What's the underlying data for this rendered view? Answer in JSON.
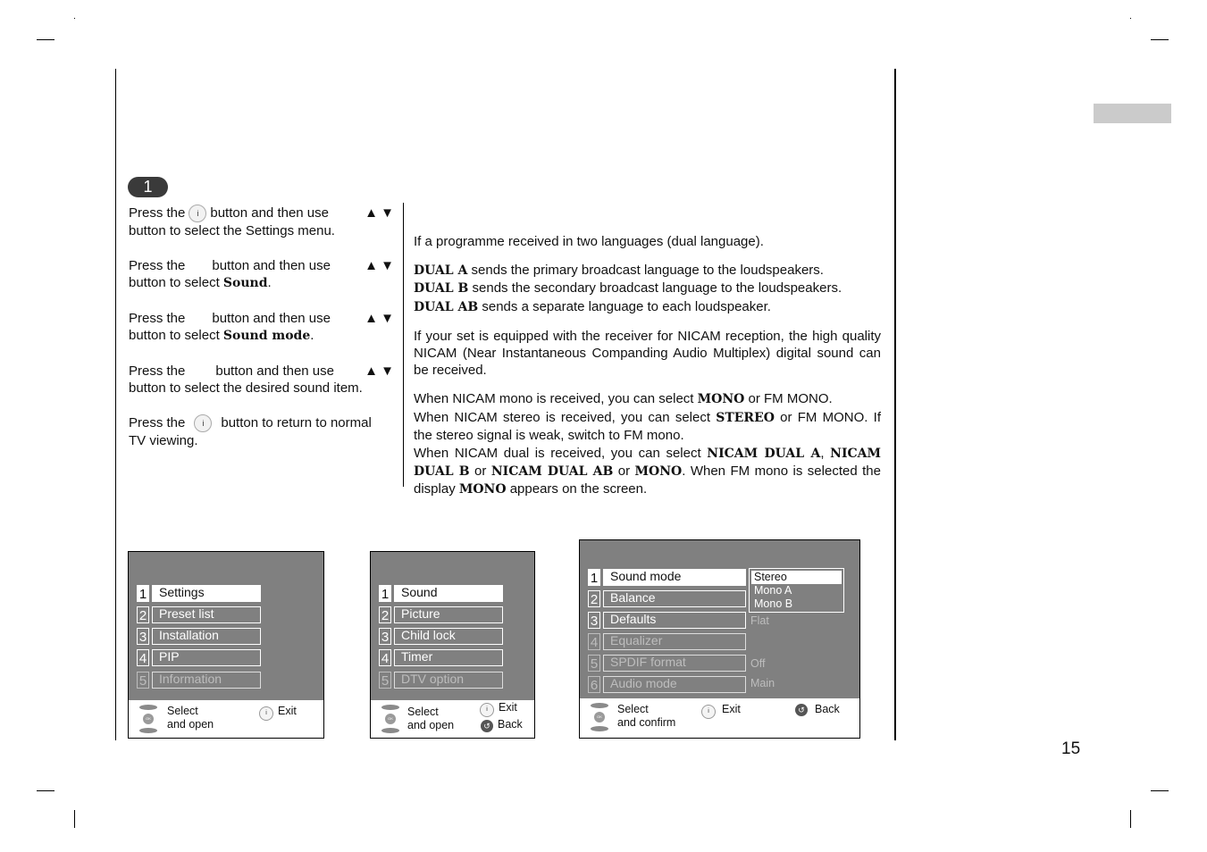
{
  "page": {
    "page_number": "15",
    "step_badge": "1"
  },
  "steps": [
    {
      "pre": "Press the",
      "button_icon": "i-button",
      "post": "button and then use",
      "arrows": [
        "▲",
        "▼"
      ],
      "line2_pre": "button to select the Settings menu.",
      "line2_bold": "",
      "line2_post": ""
    },
    {
      "pre": "Press the",
      "button_icon": "",
      "post": "button and then use",
      "arrows": [
        "▲",
        "▼"
      ],
      "line2_pre": "button to select ",
      "line2_bold": "Sound",
      "line2_post": "."
    },
    {
      "pre": "Press the",
      "button_icon": "",
      "post": "button and then use",
      "arrows": [
        "▲",
        "▼"
      ],
      "line2_pre": "button to select ",
      "line2_bold": "Sound mode",
      "line2_post": "."
    },
    {
      "pre": "Press the",
      "button_icon": "",
      "post": "button and then use",
      "arrows": [
        "▲",
        "▼"
      ],
      "line2_pre": "button to select the desired sound item.",
      "line2_bold": "",
      "line2_post": ""
    },
    {
      "pre": "Press the",
      "button_icon": "i-button",
      "post": "button to return to normal",
      "line2_pre": "TV viewing."
    }
  ],
  "right_text": {
    "intro": "If a programme received in two languages (dual language).",
    "dual": [
      {
        "bold": "DUAL A",
        "text": " sends the primary broadcast language to the loudspeakers."
      },
      {
        "bold": "DUAL B",
        "text": " sends the secondary broadcast language to the loudspeakers."
      },
      {
        "bold": "DUAL AB",
        "text": " sends a separate language to each loudspeaker."
      }
    ],
    "nicam_para": "If your set is equipped with the receiver for NICAM reception, the high quality NICAM (Near Instantaneous Companding Audio Multiplex) digital sound can be received.",
    "mono_line": {
      "a": "When NICAM mono is received, you can select ",
      "b": "MONO",
      "c": " or FM MONO."
    },
    "stereo_line": {
      "a": "When NICAM stereo is received, you can select ",
      "b": "STEREO",
      "c": " or FM MONO. If the stereo signal is weak, switch to FM mono."
    },
    "dual_line": {
      "a": "When NICAM dual is received, you can select ",
      "b1": "NICAM DUAL A",
      "c": ", ",
      "b2": "NICAM DUAL B",
      "d": " or ",
      "b3": "NICAM DUAL AB",
      "e": " or ",
      "b4": "MONO",
      "f": ". When FM mono is selected the display ",
      "b5": "MONO",
      "g": " appears on the screen."
    }
  },
  "osd1": {
    "items": [
      {
        "num": "1",
        "label": "Settings"
      },
      {
        "num": "2",
        "label": "Preset list"
      },
      {
        "num": "3",
        "label": "Installation"
      },
      {
        "num": "4",
        "label": "PIP"
      },
      {
        "num": "5",
        "label": "Information"
      }
    ],
    "footer": {
      "select": "Select",
      "select2": "and open",
      "exit": "Exit",
      "ok": "OK"
    }
  },
  "osd2": {
    "items": [
      {
        "num": "1",
        "label": "Sound"
      },
      {
        "num": "2",
        "label": "Picture"
      },
      {
        "num": "3",
        "label": "Child lock"
      },
      {
        "num": "4",
        "label": "Timer"
      },
      {
        "num": "5",
        "label": "DTV option"
      }
    ],
    "footer": {
      "select": "Select",
      "select2": "and open",
      "exit": "Exit",
      "back": "Back",
      "ok": "OK"
    }
  },
  "osd3": {
    "items": [
      {
        "num": "1",
        "label": "Sound mode",
        "value": ""
      },
      {
        "num": "2",
        "label": "Balance",
        "value": ""
      },
      {
        "num": "3",
        "label": "Defaults",
        "value": "Flat"
      },
      {
        "num": "4",
        "label": "Equalizer",
        "value": ""
      },
      {
        "num": "5",
        "label": "SPDIF format",
        "value": "Off"
      },
      {
        "num": "6",
        "label": "Audio mode",
        "value": "Main"
      }
    ],
    "dropdown": [
      "Stereo",
      "Mono A",
      "Mono B"
    ],
    "footer": {
      "select": "Select",
      "select2": "and confirm",
      "exit": "Exit",
      "back": "Back",
      "ok": "OK"
    }
  },
  "icons": {
    "info": "i",
    "back": "↺"
  }
}
